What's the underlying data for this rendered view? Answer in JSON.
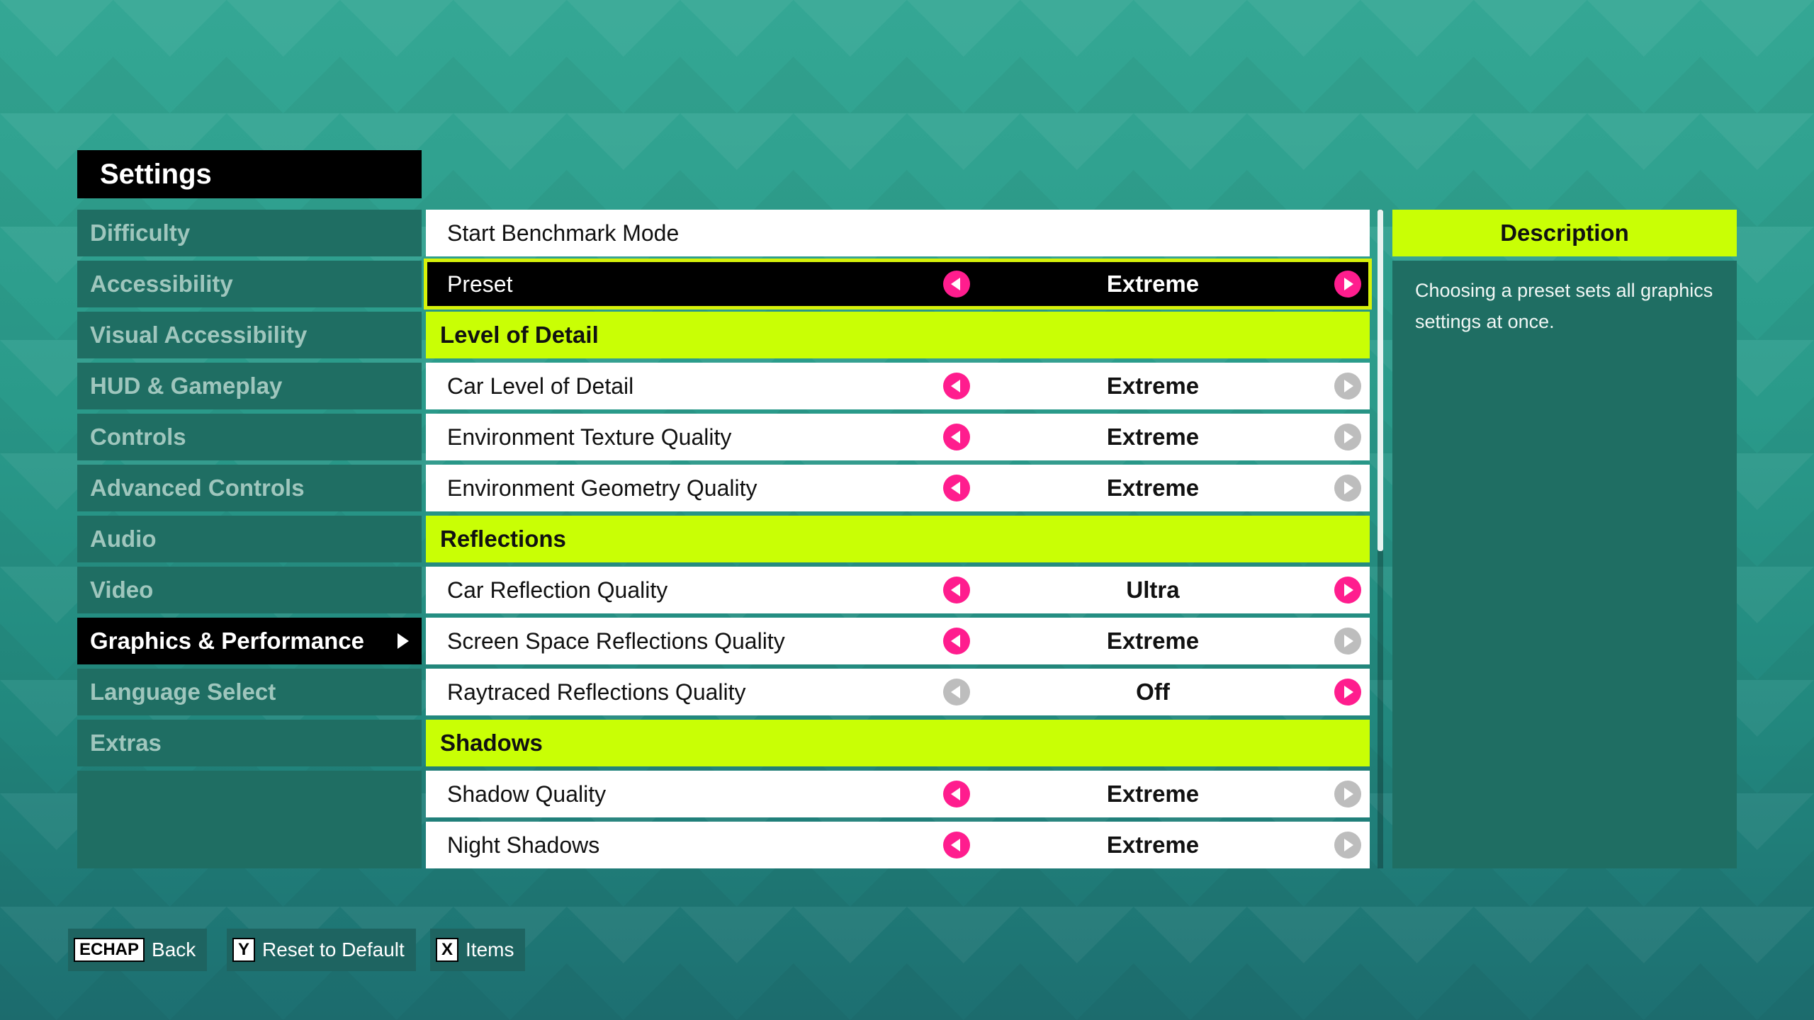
{
  "title": "Settings",
  "sidebar": {
    "items": [
      {
        "label": "Difficulty"
      },
      {
        "label": "Accessibility"
      },
      {
        "label": "Visual Accessibility"
      },
      {
        "label": "HUD & Gameplay"
      },
      {
        "label": "Controls"
      },
      {
        "label": "Advanced Controls"
      },
      {
        "label": "Audio"
      },
      {
        "label": "Video"
      },
      {
        "label": "Graphics & Performance"
      },
      {
        "label": "Language Select"
      },
      {
        "label": "Extras"
      }
    ]
  },
  "settings": {
    "benchmark": {
      "label": "Start Benchmark Mode"
    },
    "preset": {
      "label": "Preset",
      "value": "Extreme"
    },
    "lod_header": "Level of Detail",
    "car_lod": {
      "label": "Car Level of Detail",
      "value": "Extreme"
    },
    "env_texture": {
      "label": "Environment Texture Quality",
      "value": "Extreme"
    },
    "env_geometry": {
      "label": "Environment Geometry Quality",
      "value": "Extreme"
    },
    "reflections_header": "Reflections",
    "car_reflection": {
      "label": "Car Reflection Quality",
      "value": "Ultra"
    },
    "ssr": {
      "label": "Screen Space Reflections Quality",
      "value": "Extreme"
    },
    "raytraced": {
      "label": "Raytraced Reflections Quality",
      "value": "Off"
    },
    "shadows_header": "Shadows",
    "shadow_quality": {
      "label": "Shadow Quality",
      "value": "Extreme"
    },
    "night_shadows": {
      "label": "Night Shadows",
      "value": "Extreme"
    }
  },
  "description": {
    "header": "Description",
    "text": "Choosing a preset sets all graphics settings at once."
  },
  "footer": {
    "back": {
      "key": "ECHAP",
      "label": "Back"
    },
    "reset": {
      "key": "Y",
      "label": "Reset to Default"
    },
    "items": {
      "key": "X",
      "label": "Items"
    }
  },
  "colors": {
    "accent": "#c9ff05",
    "arrow_active": "#ff1d8e",
    "arrow_inactive": "#bdbdbd",
    "panel": "#1f6e63"
  }
}
